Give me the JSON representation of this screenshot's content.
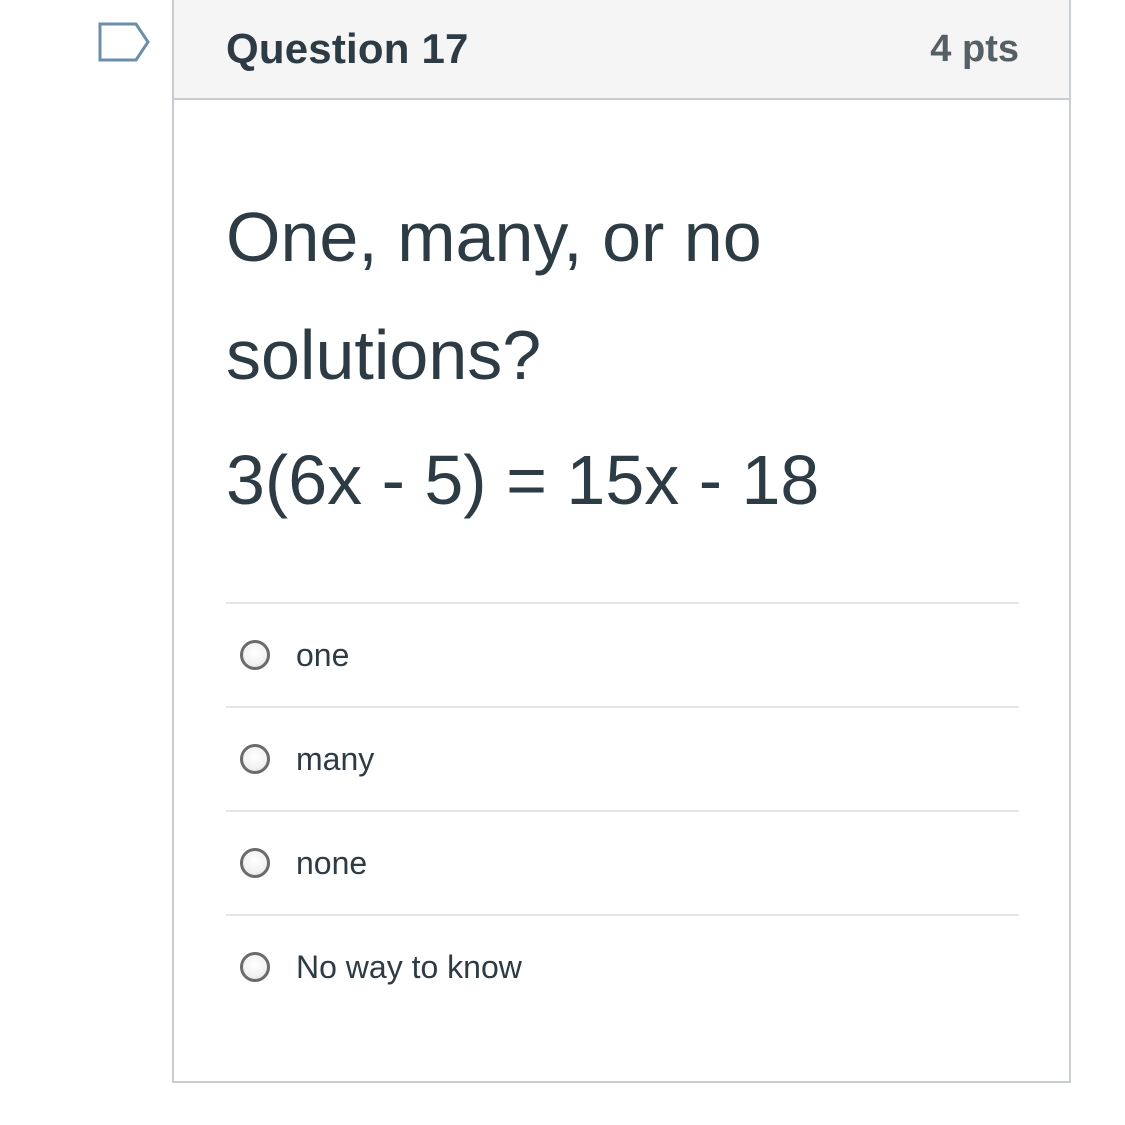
{
  "question": {
    "title": "Question 17",
    "points": "4 pts",
    "flag_icon": "bookmark-flag-icon",
    "prompt": "One, many, or no solutions?",
    "equation": "3(6x - 5) = 15x - 18",
    "answers": [
      {
        "label": "one",
        "selected": false
      },
      {
        "label": "many",
        "selected": false
      },
      {
        "label": "none",
        "selected": false
      },
      {
        "label": "No way to know",
        "selected": false
      }
    ]
  },
  "colors": {
    "text": "#2d3b45",
    "border": "#c7cdd1",
    "header_bg": "#f5f5f5",
    "flag_stroke": "#6b8fa8"
  }
}
